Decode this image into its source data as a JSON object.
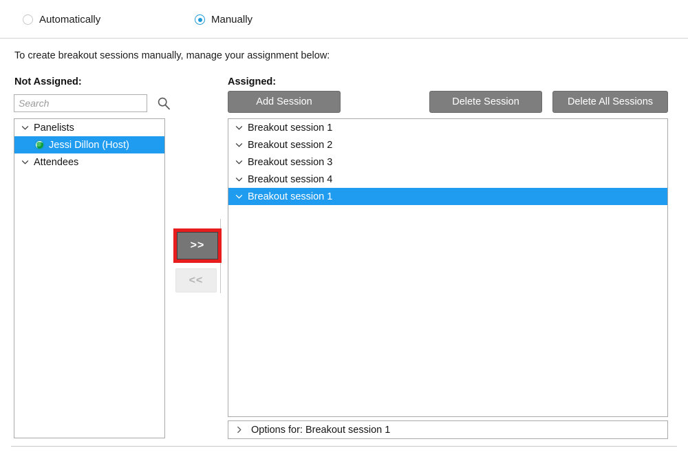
{
  "mode_options": [
    {
      "label": "Automatically",
      "selected": false,
      "name": "radio-automatically"
    },
    {
      "label": "Manually",
      "selected": true,
      "name": "radio-manually"
    }
  ],
  "instruction": "To create breakout sessions manually, manage your assignment below:",
  "left_panel": {
    "heading": "Not Assigned:",
    "search": {
      "value": "",
      "placeholder": "Search"
    },
    "tree": [
      {
        "label": "Panelists",
        "type": "group",
        "expanded": true,
        "selected": false
      },
      {
        "label": "Jessi Dillon (Host)",
        "type": "person",
        "selected": true
      },
      {
        "label": "Attendees",
        "type": "group",
        "expanded": true,
        "selected": false
      }
    ]
  },
  "transfer": {
    "assign_label": ">>",
    "unassign_label": "<<",
    "assign_highlight_color": "#e81d1d",
    "unassign_disabled": true
  },
  "right_panel": {
    "heading": "Assigned:",
    "buttons": {
      "add": "Add Session",
      "delete": "Delete Session",
      "delete_all": "Delete All Sessions"
    },
    "sessions": [
      {
        "label": "Breakout session 1",
        "selected": false
      },
      {
        "label": "Breakout session 2",
        "selected": false
      },
      {
        "label": "Breakout session 3",
        "selected": false
      },
      {
        "label": "Breakout session 4",
        "selected": false
      },
      {
        "label": "Breakout session 1",
        "selected": true
      }
    ],
    "options_bar": "Options for: Breakout session 1"
  },
  "colors": {
    "selection_blue": "#1f9bef",
    "accent_blue": "#1a9ad7",
    "button_gray": "#7e7e7e",
    "highlight_red": "#e81d1d"
  }
}
